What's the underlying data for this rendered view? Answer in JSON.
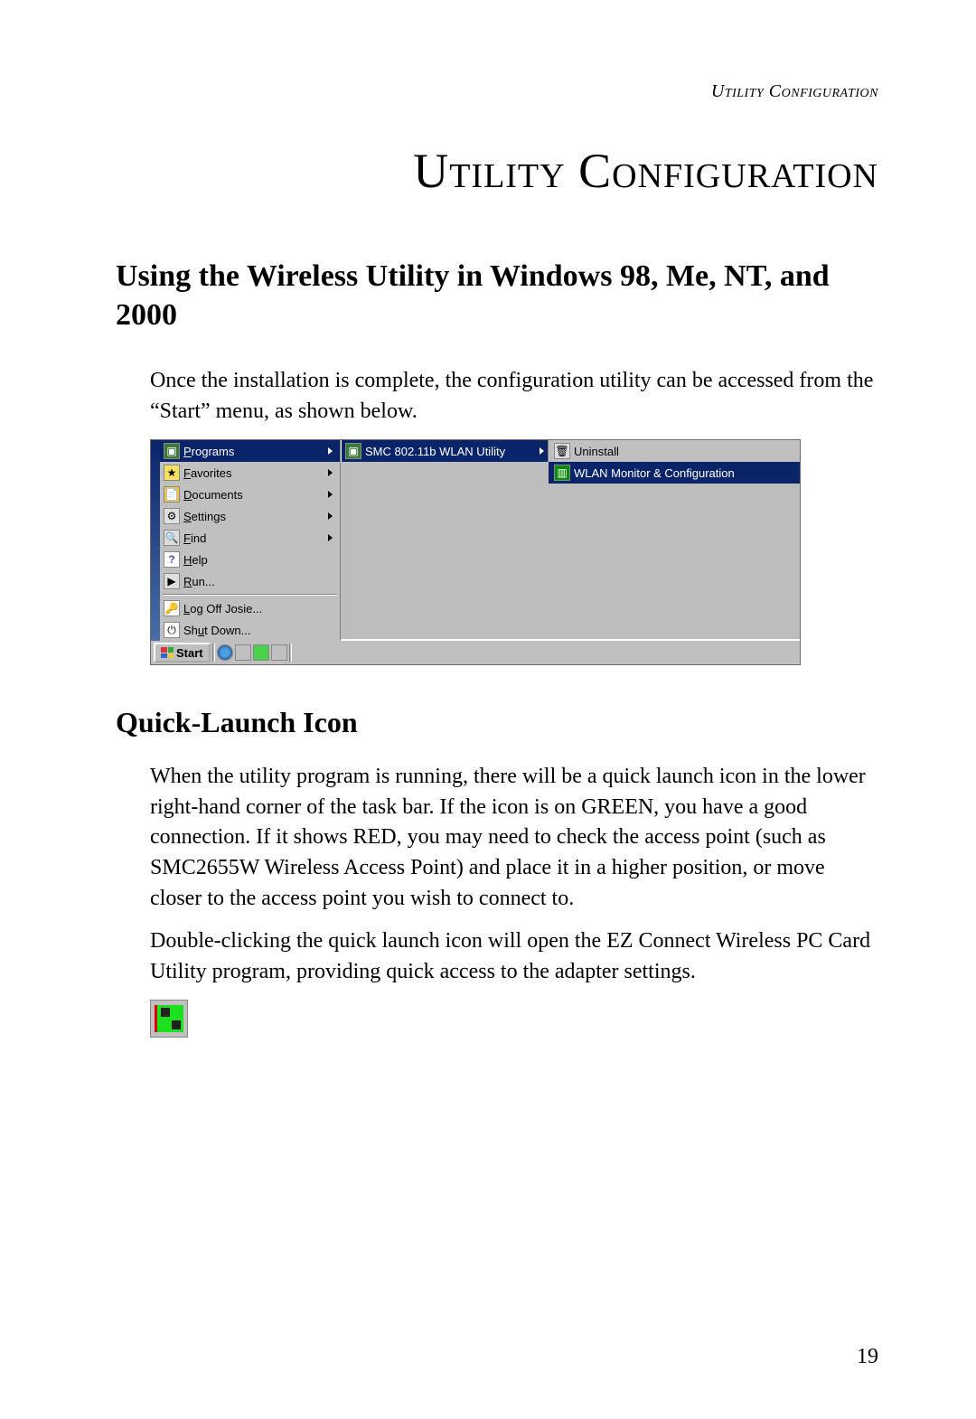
{
  "header": "Utility Configuration",
  "title": "Utility Configuration",
  "section1": {
    "heading": "Using the Wireless Utility in Windows 98, Me, NT, and 2000",
    "para1": "Once the installation is complete, the configuration utility can be accessed from the “Start” menu, as shown below."
  },
  "section2": {
    "heading": "Quick-Launch Icon",
    "para1": "When the utility program is running, there will be a quick launch icon in the lower right-hand corner of the task bar. If the icon is on GREEN, you have a good connection. If it shows RED, you may need to check the access point (such as SMC2655W Wireless Access Point) and place it in a higher position, or move closer to the access point you wish to connect to.",
    "para2": "Double-clicking the quick launch icon will open the EZ Connect Wireless PC Card Utility program, providing quick access to the adapter settings."
  },
  "startmenu": {
    "items": [
      {
        "label": "Programs",
        "key": "P"
      },
      {
        "label": "Favorites",
        "key": "F"
      },
      {
        "label": "Documents",
        "key": "D"
      },
      {
        "label": "Settings",
        "key": "S"
      },
      {
        "label": "Find",
        "key": "F"
      },
      {
        "label": "Help",
        "key": "H"
      },
      {
        "label": "Run...",
        "key": "R"
      },
      {
        "label": "Log Off Josie...",
        "key": "L"
      },
      {
        "label": "Shut Down...",
        "key": "u"
      }
    ],
    "submenu1": "SMC 802.11b WLAN Utility",
    "submenu2": [
      {
        "label": "Uninstall"
      },
      {
        "label": "WLAN Monitor & Configuration"
      }
    ]
  },
  "taskbar": {
    "start": "Start"
  },
  "pagenum": "19"
}
